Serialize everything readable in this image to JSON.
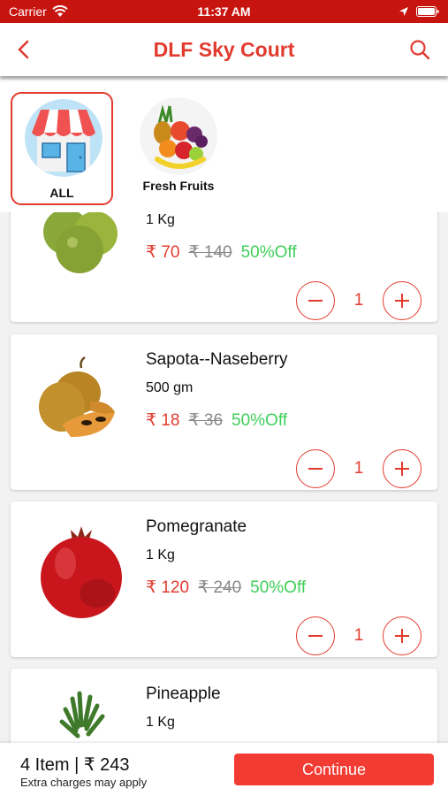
{
  "status_bar": {
    "carrier": "Carrier",
    "time": "11:37 AM"
  },
  "header": {
    "title": "DLF Sky Court",
    "back_icon": "chevron-left-icon",
    "search_icon": "search-icon"
  },
  "categories": [
    {
      "label": "ALL",
      "selected": true,
      "icon": "store-icon"
    },
    {
      "label": "Fresh Fruits",
      "selected": false,
      "icon": "fruit-basket-icon"
    }
  ],
  "products": [
    {
      "name": "",
      "qty": "1 Kg",
      "price": "₹ 70",
      "old_price": "₹ 140",
      "discount": "50%Off",
      "count": "1"
    },
    {
      "name": "Sapota--Naseberry",
      "qty": "500 gm",
      "price": "₹ 18",
      "old_price": "₹ 36",
      "discount": "50%Off",
      "count": "1"
    },
    {
      "name": "Pomegranate",
      "qty": "1 Kg",
      "price": "₹ 120",
      "old_price": "₹ 240",
      "discount": "50%Off",
      "count": "1"
    },
    {
      "name": "Pineapple",
      "qty": "1 Kg"
    }
  ],
  "footer": {
    "summary": "4 Item | ₹ 243",
    "note": "Extra charges may apply",
    "continue_label": "Continue"
  },
  "colors": {
    "accent": "#e23b2e",
    "status_bar": "#c8140f",
    "discount": "#3fcf5a",
    "button": "#f23b32"
  }
}
